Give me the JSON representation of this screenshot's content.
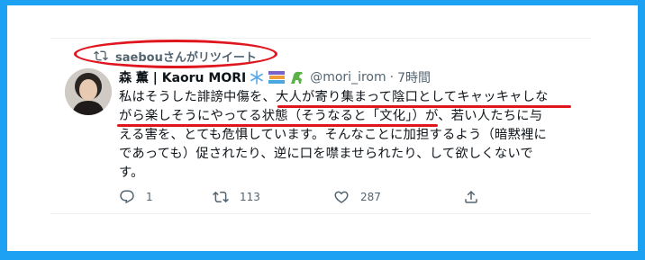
{
  "retweet": {
    "text": "saebouさんがリツイート"
  },
  "author": {
    "display_name": "森 薫 | Kaoru MORI",
    "handle": "@mori_irom",
    "separator": "·",
    "time": "7時間"
  },
  "tweet": {
    "lines": [
      "私はそうした誹謗中傷を、大人が寄り集まって陰口としてキャッキャしな",
      "がら楽しそうにやってる状態（そうなると「文化」）が、若い人たちに与",
      "える害を、とても危惧しています。そんなことに加担するよう（暗黙裡に",
      "であっても）促されたり、逆に口を噤ませられたり、して欲しくないで",
      "す。"
    ]
  },
  "actions": {
    "reply_count": "1",
    "retweet_count": "113",
    "like_count": "287"
  },
  "colors": {
    "frame": "#1da1f2",
    "annotation_red": "#e0161f",
    "secondary_text": "#536471"
  }
}
